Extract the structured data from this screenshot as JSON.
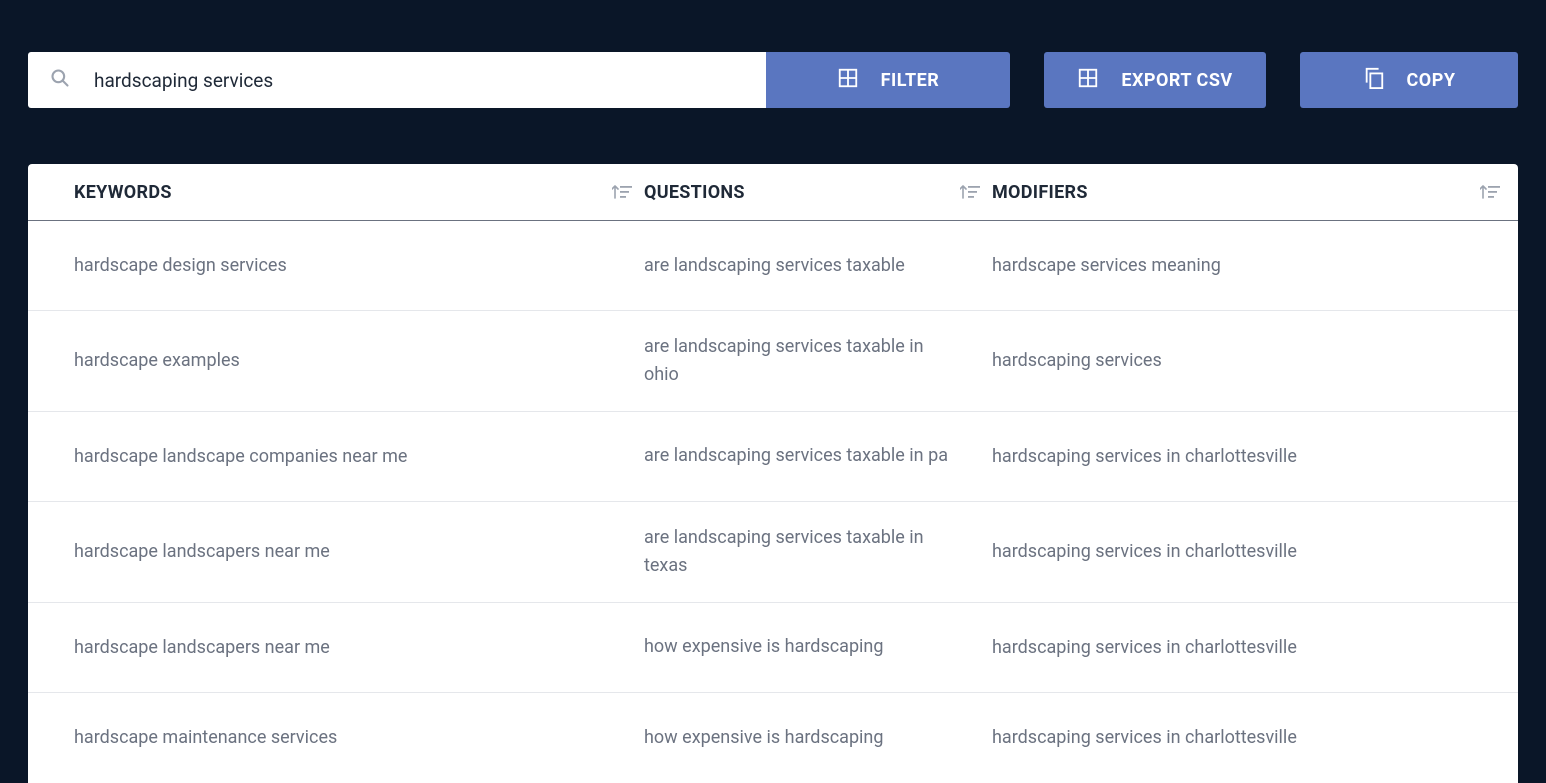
{
  "toolbar": {
    "search_value": "hardscaping services",
    "filter_label": "FILTER",
    "export_label": "EXPORT CSV",
    "copy_label": "COPY"
  },
  "table": {
    "headers": {
      "keywords": "KEYWORDS",
      "questions": "QUESTIONS",
      "modifiers": "MODIFIERS"
    },
    "rows": [
      {
        "k": "hardscape design services",
        "q": "are landscaping services taxable",
        "m": "hardscape services meaning"
      },
      {
        "k": "hardscape examples",
        "q": "are landscaping services taxable in ohio",
        "m": "hardscaping services"
      },
      {
        "k": "hardscape landscape companies near me",
        "q": "are landscaping services taxable in pa",
        "m": "hardscaping services in charlottesville"
      },
      {
        "k": "hardscape landscapers near me",
        "q": "are landscaping services taxable in texas",
        "m": "hardscaping services in charlottesville"
      },
      {
        "k": "hardscape landscapers near me",
        "q": "how expensive is hardscaping",
        "m": "hardscaping services in charlottesville"
      },
      {
        "k": "hardscape maintenance services",
        "q": "how expensive is hardscaping",
        "m": "hardscaping services in charlottesville"
      }
    ]
  }
}
